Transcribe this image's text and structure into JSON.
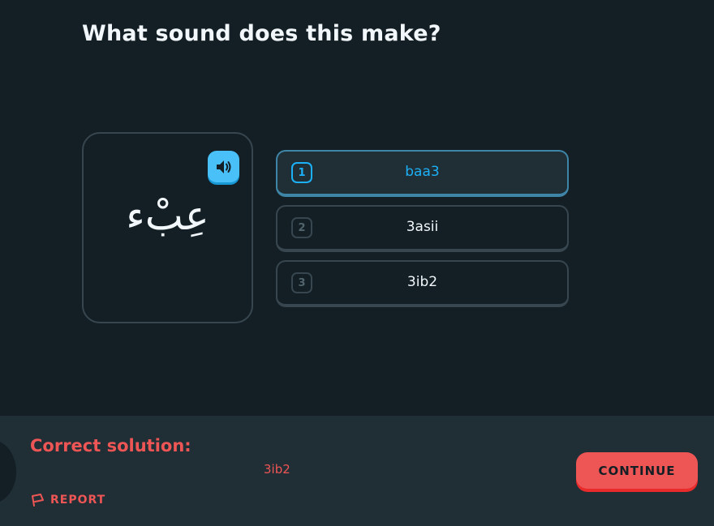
{
  "question": {
    "title": "What sound does this make?"
  },
  "card": {
    "character": "عِبْء",
    "audio_icon": "speaker-icon",
    "accent_color": "#49c0f8"
  },
  "options": [
    {
      "key": "1",
      "label": "baa3",
      "selected": true
    },
    {
      "key": "2",
      "label": "3asii",
      "selected": false
    },
    {
      "key": "3",
      "label": "3ib2",
      "selected": false
    }
  ],
  "footer": {
    "heading": "Correct solution:",
    "solution": "3ib2",
    "report_label": "REPORT",
    "report_icon": "flag-icon",
    "continue_label": "CONTINUE",
    "error_color": "#ee5555"
  }
}
